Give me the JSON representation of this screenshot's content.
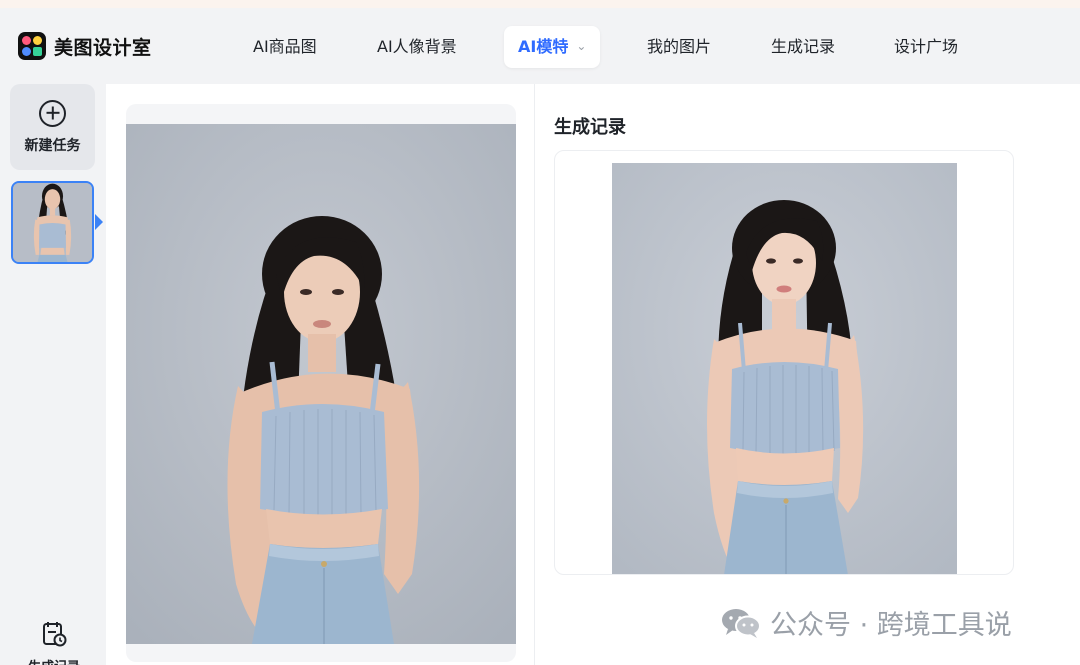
{
  "brand": {
    "name": "美图设计室"
  },
  "nav": {
    "items": [
      {
        "label": "AI商品图"
      },
      {
        "label": "AI人像背景"
      },
      {
        "label": "AI模特"
      },
      {
        "label": "我的图片"
      },
      {
        "label": "生成记录"
      },
      {
        "label": "设计广场"
      }
    ],
    "active_index": 2
  },
  "sidebar": {
    "new_task_label": "新建任务",
    "history_label": "生成记录"
  },
  "right_panel": {
    "title": "生成记录"
  },
  "watermark": {
    "text": "公众号 · 跨境工具说"
  },
  "colors": {
    "accent": "#2f6bff",
    "selected_border": "#3b82f6",
    "backdrop": "#b7bdc7",
    "top_color": "#a9bcd3",
    "jeans_color": "#9cb6cf",
    "hair_color": "#1b1716",
    "skin_color": "#e8c4ae"
  }
}
